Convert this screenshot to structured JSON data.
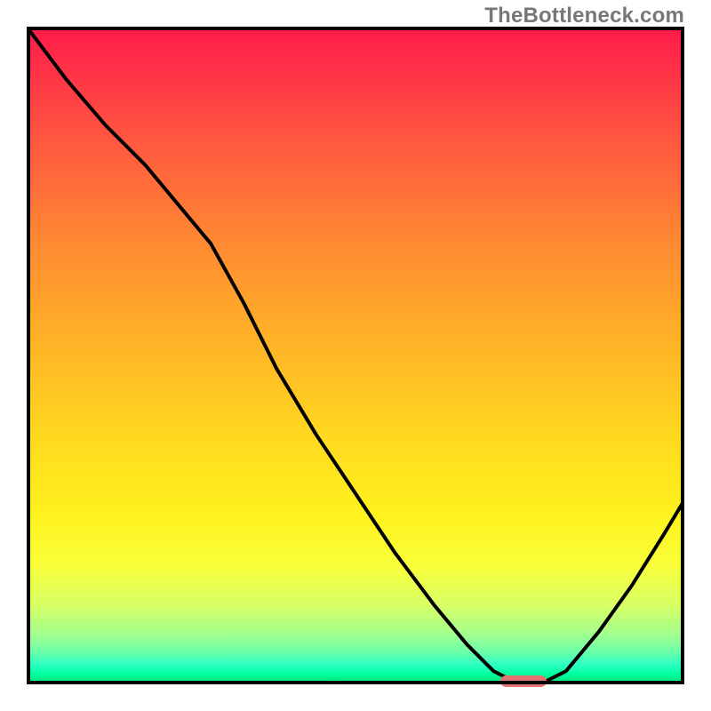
{
  "watermark": "TheBottleneck.com",
  "chart_data": {
    "type": "line",
    "title": "",
    "xlabel": "",
    "ylabel": "",
    "xlim": [
      0,
      100
    ],
    "ylim": [
      0,
      100
    ],
    "grid": false,
    "legend": false,
    "x": [
      0,
      6,
      12,
      18,
      23,
      28,
      33,
      38,
      44,
      50,
      56,
      62,
      67,
      71,
      75,
      78,
      82,
      87,
      92,
      97,
      100
    ],
    "y": [
      100,
      92,
      85,
      79,
      73,
      67,
      58,
      48,
      38,
      29,
      20,
      12,
      6,
      2,
      0,
      0,
      2,
      8,
      15,
      23,
      28
    ],
    "marker": {
      "x_start": 72,
      "x_end": 79,
      "y": 0,
      "color": "#e57373"
    },
    "gradient_stops": [
      {
        "pos": 0.0,
        "color": "#ff1a4a"
      },
      {
        "pos": 0.18,
        "color": "#ff5a3f"
      },
      {
        "pos": 0.48,
        "color": "#ffb327"
      },
      {
        "pos": 0.74,
        "color": "#fff21e"
      },
      {
        "pos": 0.92,
        "color": "#a8ff8a"
      },
      {
        "pos": 1.0,
        "color": "#00e07a"
      }
    ]
  }
}
